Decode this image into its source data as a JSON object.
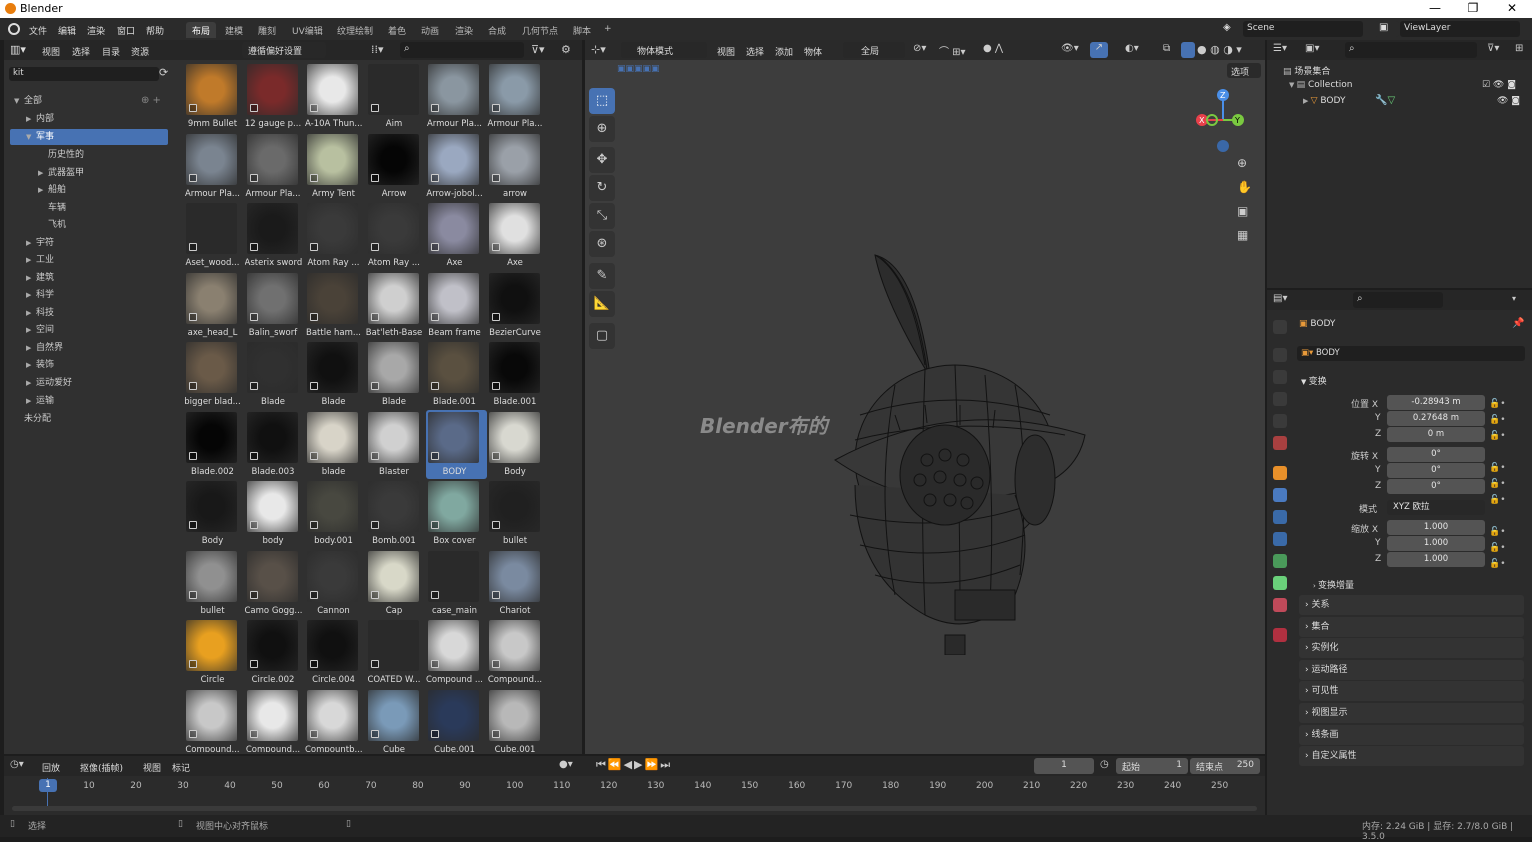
{
  "window": {
    "title": "Blender",
    "controls": [
      "—",
      "❐",
      "✕"
    ]
  },
  "menu": [
    "文件",
    "编辑",
    "渲染",
    "窗口",
    "帮助"
  ],
  "workspaces": [
    "布局",
    "建模",
    "雕刻",
    "UV编辑",
    "纹理绘制",
    "着色",
    "动画",
    "渲染",
    "合成",
    "几何节点",
    "脚本",
    "+"
  ],
  "scene": "Scene",
  "viewlayer": "ViewLayer",
  "assetbrowser": {
    "header": [
      "视图",
      "选择",
      "目录",
      "资源"
    ],
    "library": "遵循偏好设置",
    "filter": "kit",
    "tree": [
      {
        "label": "全部",
        "indent": 0,
        "arrow": "▼"
      },
      {
        "label": "内部",
        "indent": 1,
        "arrow": "▶"
      },
      {
        "label": "军事",
        "indent": 1,
        "arrow": "▼",
        "selected": true
      },
      {
        "label": "历史性的",
        "indent": 2,
        "arrow": ""
      },
      {
        "label": "武器盔甲",
        "indent": 2,
        "arrow": "▶"
      },
      {
        "label": "船舶",
        "indent": 2,
        "arrow": "▶"
      },
      {
        "label": "车辆",
        "indent": 2,
        "arrow": ""
      },
      {
        "label": "飞机",
        "indent": 2,
        "arrow": ""
      },
      {
        "label": "宇符",
        "indent": 1,
        "arrow": "▶"
      },
      {
        "label": "工业",
        "indent": 1,
        "arrow": "▶"
      },
      {
        "label": "建筑",
        "indent": 1,
        "arrow": "▶"
      },
      {
        "label": "科学",
        "indent": 1,
        "arrow": "▶"
      },
      {
        "label": "科技",
        "indent": 1,
        "arrow": "▶"
      },
      {
        "label": "空间",
        "indent": 1,
        "arrow": "▶"
      },
      {
        "label": "自然界",
        "indent": 1,
        "arrow": "▶"
      },
      {
        "label": "装饰",
        "indent": 1,
        "arrow": "▶"
      },
      {
        "label": "运动爱好",
        "indent": 1,
        "arrow": "▶"
      },
      {
        "label": "运输",
        "indent": 1,
        "arrow": "▶"
      },
      {
        "label": "未分配",
        "indent": 0,
        "arrow": ""
      }
    ],
    "assets": [
      {
        "name": "9mm Bullet",
        "color": "#c07a2a"
      },
      {
        "name": "12 gauge p...",
        "color": "#7a2a2a"
      },
      {
        "name": "A-10A Thun...",
        "color": "#e8e8e8"
      },
      {
        "name": "Aim",
        "color": "#2a2a2a"
      },
      {
        "name": "Armour Pla...",
        "color": "#8a96a0"
      },
      {
        "name": "Armour Pla...",
        "color": "#8a9aa8"
      },
      {
        "name": "Armour Pla...",
        "color": "#7a8490"
      },
      {
        "name": "Armour Pla...",
        "color": "#6a6a6a"
      },
      {
        "name": "Army Tent",
        "color": "#b8c0a0"
      },
      {
        "name": "Arrow",
        "color": "#050505"
      },
      {
        "name": "Arrow-jobol...",
        "color": "#9aa8c0"
      },
      {
        "name": "arrow",
        "color": "#9aa0a8"
      },
      {
        "name": "Aset_wood...",
        "color": "#2a2a2a"
      },
      {
        "name": "Asterix sword",
        "color": "#1a1a1a"
      },
      {
        "name": "Atom Ray ...",
        "color": "#3a3a3a"
      },
      {
        "name": "Atom Ray ...",
        "color": "#3a3a3a"
      },
      {
        "name": "Axe",
        "color": "#8a8aa0"
      },
      {
        "name": "Axe",
        "color": "#e0e0e0"
      },
      {
        "name": "axe_head_L",
        "color": "#8a8070"
      },
      {
        "name": "Balin_sworf",
        "color": "#707070"
      },
      {
        "name": "Battle ham...",
        "color": "#4a4238"
      },
      {
        "name": "Bat'leth-Base",
        "color": "#cfcfcf"
      },
      {
        "name": "Beam frame",
        "color": "#c0c0c8"
      },
      {
        "name": "BezierCurve",
        "color": "#101010"
      },
      {
        "name": "bigger blad...",
        "color": "#6a5a48"
      },
      {
        "name": "Blade",
        "color": "#303030"
      },
      {
        "name": "Blade",
        "color": "#101010"
      },
      {
        "name": "Blade",
        "color": "#a8a8a8"
      },
      {
        "name": "Blade.001",
        "color": "#5a5040"
      },
      {
        "name": "Blade.001",
        "color": "#080808"
      },
      {
        "name": "Blade.002",
        "color": "#050505"
      },
      {
        "name": "Blade.003",
        "color": "#101010"
      },
      {
        "name": "blade",
        "color": "#d8d4c8"
      },
      {
        "name": "Blaster",
        "color": "#d0d0d0"
      },
      {
        "name": "BODY",
        "color": "#5a6a88",
        "selected": true
      },
      {
        "name": "Body",
        "color": "#d8d8d0"
      },
      {
        "name": "Body",
        "color": "#181818"
      },
      {
        "name": "body",
        "color": "#e8e8e8"
      },
      {
        "name": "body.001",
        "color": "#484840"
      },
      {
        "name": "Bomb.001",
        "color": "#3a3a3a"
      },
      {
        "name": "Box cover",
        "color": "#80a8a0"
      },
      {
        "name": "bullet",
        "color": "#202020"
      },
      {
        "name": "bullet",
        "color": "#909090"
      },
      {
        "name": "Camo Gogg...",
        "color": "#585048"
      },
      {
        "name": "Cannon",
        "color": "#3a3a3a"
      },
      {
        "name": "Cap",
        "color": "#d8d8c8"
      },
      {
        "name": "case_main",
        "color": "#2a2a2a"
      },
      {
        "name": "Chariot",
        "color": "#7a8aa0"
      },
      {
        "name": "Circle",
        "color": "#e8a020"
      },
      {
        "name": "Circle.002",
        "color": "#101010"
      },
      {
        "name": "Circle.004",
        "color": "#101010"
      },
      {
        "name": "COATED W...",
        "color": "#2a2a2a"
      },
      {
        "name": "Compound ...",
        "color": "#d8d8d8"
      },
      {
        "name": "Compound...",
        "color": "#c8c8c8"
      },
      {
        "name": "Compound...",
        "color": "#c8c8c8"
      },
      {
        "name": "Compound...",
        "color": "#e8e8e8"
      },
      {
        "name": "Compountb...",
        "color": "#d8d8d8"
      },
      {
        "name": "Cube",
        "color": "#7a9ab8"
      },
      {
        "name": "Cube.001",
        "color": "#2a3a5a"
      },
      {
        "name": "Cube.001",
        "color": "#b8b8b8"
      }
    ]
  },
  "viewport": {
    "mode": "物体模式",
    "menu": [
      "视图",
      "选择",
      "添加",
      "物体"
    ],
    "orientation": "全局",
    "options": "选项",
    "watermark": "Blender布的",
    "axes": {
      "x": "X",
      "y": "Y",
      "z": "Z"
    }
  },
  "outliner": {
    "scene_collection": "场景集合",
    "collection": "Collection",
    "object": "BODY"
  },
  "properties": {
    "object_name": "BODY",
    "data_name": "BODY",
    "transform_label": "变换",
    "location_label": "位置 X",
    "location": {
      "x": "-0.28943 m",
      "y": "0.27648 m",
      "z": "0 m"
    },
    "rotation_label": "旋转 X",
    "rotation": {
      "x": "0°",
      "y": "0°",
      "z": "0°"
    },
    "mode_label": "模式",
    "mode": "XYZ 欧拉",
    "scale_label": "缩放 X",
    "scale": {
      "x": "1.000",
      "y": "1.000",
      "z": "1.000"
    },
    "axis_y": "Y",
    "axis_z": "Z",
    "delta": "变换增量",
    "sections": [
      "关系",
      "集合",
      "实例化",
      "运动路径",
      "可见性",
      "视图显示",
      "线条画",
      "自定义属性"
    ]
  },
  "timeline": {
    "menu": [
      "回放",
      "抠像(插帧)",
      "视图",
      "标记"
    ],
    "current_frame": "1",
    "start_label": "起始",
    "start": "1",
    "end_label": "结束点",
    "end": "250",
    "ticks": [
      "1",
      "10",
      "20",
      "30",
      "40",
      "50",
      "60",
      "70",
      "80",
      "90",
      "100",
      "110",
      "120",
      "130",
      "140",
      "150",
      "160",
      "170",
      "180",
      "190",
      "200",
      "210",
      "220",
      "230",
      "240",
      "250"
    ]
  },
  "status": {
    "select": "选择",
    "center": "视图中心对齐鼠标",
    "memory": "内存: 2.24 GiB | 显存: 2.7/8.0 GiB | 3.5.0"
  }
}
